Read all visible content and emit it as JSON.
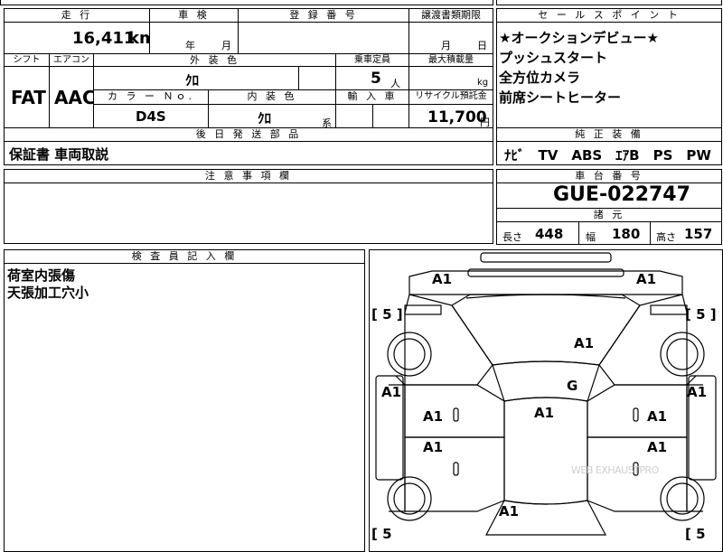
{
  "sheet": {
    "mileage_label": "走 行",
    "mileage_value": "16,411",
    "mileage_unit": "km",
    "shaken_label": "車 検",
    "shaken_year": "年",
    "shaken_month": "月",
    "reg_label": "登 録 番 号",
    "transfer_label": "譲渡書類期限",
    "transfer_month": "月",
    "transfer_day": "日",
    "shift_label": "シフト",
    "shift_value": "FAT",
    "ac_label": "エアコン",
    "ac_value": "AAC",
    "exterior_label": "外 装 色",
    "exterior_value": "ｸﾛ",
    "capacity_label": "乗車定員",
    "capacity_value": "5",
    "capacity_unit": "人",
    "load_label": "最大積載量",
    "load_unit": "kg",
    "color_no_label": "カ ラ ー Ｎｏ.",
    "color_no_value": "D4S",
    "interior_label": "内 装 色",
    "interior_value": "ｸﾛ",
    "interior_suffix": "系",
    "import_label": "輸 入 車",
    "recycle_label": "リサイクル預託金",
    "recycle_value": "11,700",
    "recycle_unit": "円",
    "later_parts_label": "後 日 発 送 部 品",
    "later_parts_value": "保証書 車両取説",
    "notes_label": "注 意 事 項 欄",
    "inspector_label": "検 査 員 記 入 欄",
    "inspector_lines": [
      "荷室内張傷",
      "天張加工穴小"
    ]
  },
  "sales": {
    "label": "セ ー ル ス ポ イ ン ト",
    "points": [
      "★オークションデビュー★",
      "プッシュスタート",
      "全方位カメラ",
      "前席シートヒーター"
    ]
  },
  "equipment": {
    "label": "純 正 装 備",
    "value": "ﾅﾋﾞ　TV　ABS　ｴｱB　PS　PW"
  },
  "chassis": {
    "label": "車 台 番 号",
    "value": "GUE-022747"
  },
  "dimensions": {
    "label": "諸 元",
    "length_label": "長さ",
    "length_value": "448",
    "width_label": "幅",
    "width_value": "180",
    "height_label": "高さ",
    "height_value": "157"
  },
  "diagram": {
    "tires": {
      "fl": "[ 5 ]",
      "fr": "[ 5 ]",
      "rl": "[ 5",
      "rr": "[ 5"
    },
    "marks": {
      "front_left_corner": "A1",
      "front_right_corner": "A1",
      "hood": "A1",
      "left_fender": "A1",
      "right_fender": "A1",
      "windshield": "G",
      "roof": "A1",
      "left_front_door": "A1",
      "right_front_door": "A1",
      "left_rear_door": "A1",
      "right_rear_door": "A1",
      "rear": "A1"
    }
  },
  "watermark": "WEB EXHAUSTPRO"
}
